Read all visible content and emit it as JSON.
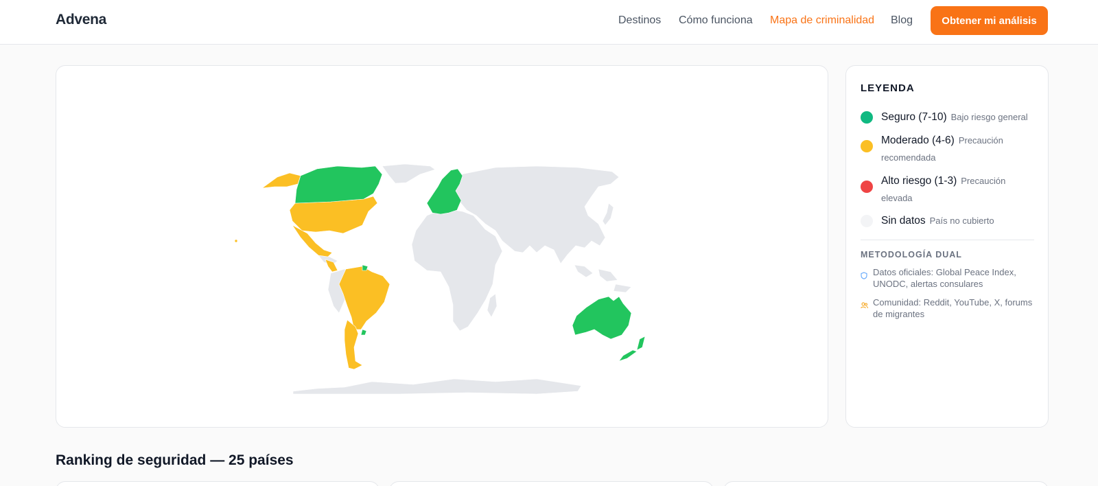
{
  "header": {
    "logo": "Advena",
    "nav": [
      "Destinos",
      "Cómo funciona",
      "Mapa de criminalidad",
      "Blog"
    ],
    "active_nav": "Mapa de criminalidad",
    "cta_label": "Obtener mi análisis"
  },
  "legend": {
    "title": "LEYENDA",
    "items": [
      {
        "label": "Seguro (7-10)",
        "desc": "Bajo riesgo general",
        "color": "#10b981"
      },
      {
        "label": "Moderado (4-6)",
        "desc": "Precaución recomendada",
        "color": "#fbbf24"
      },
      {
        "label": "Alto riesgo (1-3)",
        "desc": "Precaución elevada",
        "color": "#ef4444"
      },
      {
        "label": "Sin datos",
        "desc": "País no cubierto",
        "color": "#f3f4f6"
      }
    ],
    "methodology_title": "METODOLOGÍA DUAL",
    "methodology": [
      {
        "icon": "shield-icon",
        "text": "Datos oficiales: Global Peace Index, UNODC, alertas consulares"
      },
      {
        "icon": "users-icon",
        "text": "Comunidad: Reddit, YouTube, X, forums de migrantes"
      }
    ]
  },
  "map": {
    "colors": {
      "safe": "#22c55e",
      "moderate": "#fbbf24",
      "no_data": "#e5e7eb"
    }
  },
  "ranking": {
    "title": "Ranking de seguridad — 25 países"
  }
}
